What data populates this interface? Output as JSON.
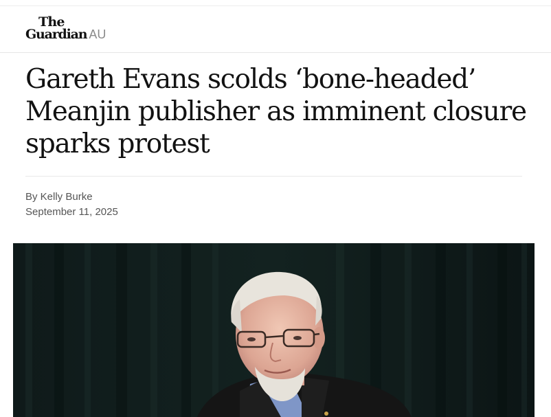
{
  "masthead": {
    "logo_line1": "The",
    "logo_line2": "Guardian",
    "edition": "AU"
  },
  "article": {
    "headline": "Gareth Evans scolds ‘bone-headed’ Meanjin publisher as imminent closure sparks protest",
    "byline": "By Kelly Burke",
    "date": "September 11, 2025"
  },
  "colors": {
    "text": "#121212",
    "meta": "#555555",
    "edition": "#8a8a8a",
    "photo_background": "#0d1717"
  }
}
